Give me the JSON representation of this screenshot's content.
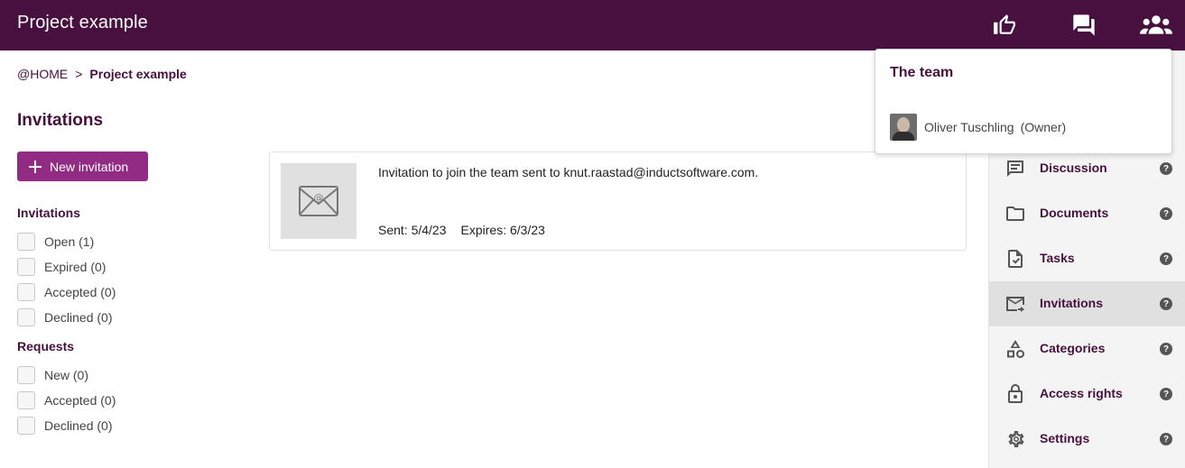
{
  "header": {
    "title": "Project example",
    "icons": [
      "thumbs-up-icon",
      "chat-icon",
      "team-icon"
    ]
  },
  "breadcrumb": {
    "home": "@HOME",
    "separator": ">",
    "current": "Project example"
  },
  "page": {
    "title": "Invitations",
    "new_button": "New invitation"
  },
  "filters": {
    "invitations_heading": "Invitations",
    "invitations": [
      "Open (1)",
      "Expired (0)",
      "Accepted (0)",
      "Declined (0)"
    ],
    "requests_heading": "Requests",
    "requests": [
      "New (0)",
      "Accepted (0)",
      "Declined (0)"
    ]
  },
  "invitation": {
    "text": "Invitation to join the team sent to knut.raastad@inductsoftware.com.",
    "sent": "Sent: 5/4/23",
    "expires": "Expires: 6/3/23"
  },
  "team_popup": {
    "title": "The team",
    "member_name": "Oliver Tuschling",
    "member_role": "(Owner)"
  },
  "sidebar": {
    "items": [
      {
        "label": "Discussion",
        "icon": "discussion-icon"
      },
      {
        "label": "Documents",
        "icon": "folder-icon"
      },
      {
        "label": "Tasks",
        "icon": "task-icon"
      },
      {
        "label": "Invitations",
        "icon": "mail-icon",
        "active": true
      },
      {
        "label": "Categories",
        "icon": "shapes-icon"
      },
      {
        "label": "Access rights",
        "icon": "lock-icon"
      },
      {
        "label": "Settings",
        "icon": "gear-icon"
      }
    ],
    "help_glyph": "?"
  },
  "colors": {
    "brand": "#47103e",
    "button": "#922b84"
  }
}
